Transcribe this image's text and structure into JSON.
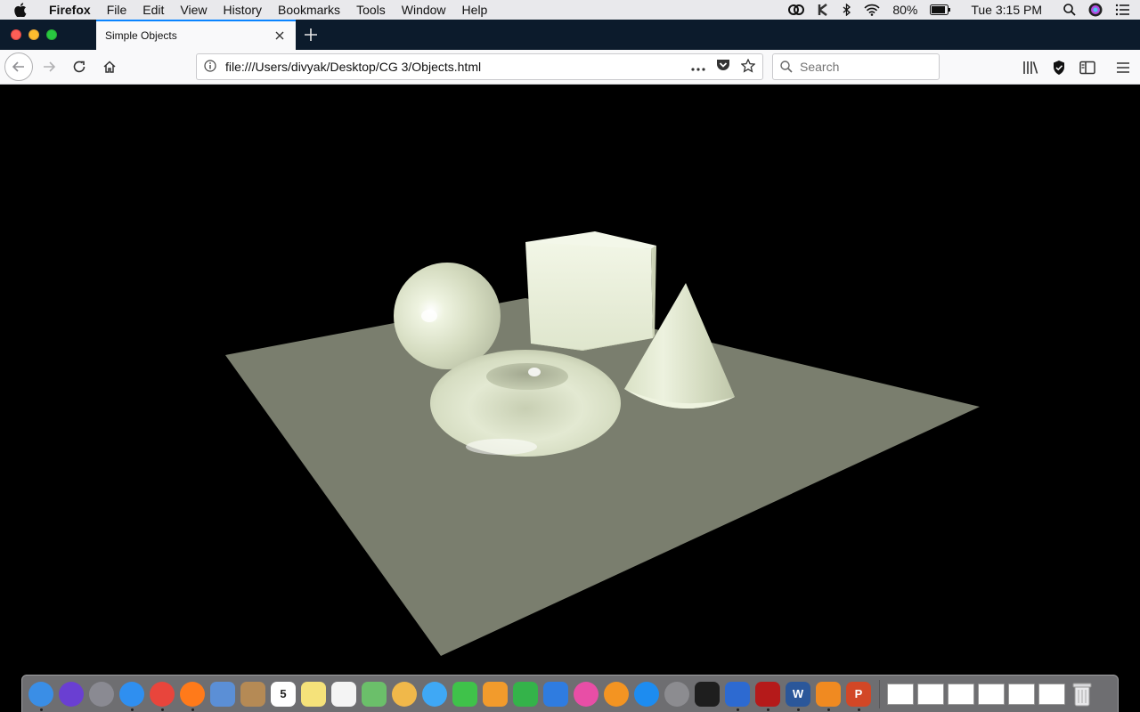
{
  "menubar": {
    "app_name": "Firefox",
    "items": [
      "File",
      "Edit",
      "View",
      "History",
      "Bookmarks",
      "Tools",
      "Window",
      "Help"
    ],
    "battery": "80%",
    "clock": "Tue 3:15 PM"
  },
  "tabs": [
    {
      "title": "Simple Objects",
      "active": true
    }
  ],
  "toolbar": {
    "url": "file:///Users/divyak/Desktop/CG 3/Objects.html",
    "search_placeholder": "Search"
  },
  "scene": {
    "background": "#000000",
    "plane_color": "#7a7e6e",
    "object_color": "#e4ebd3",
    "objects": [
      "sphere",
      "cube",
      "torus",
      "cone"
    ]
  },
  "dock": {
    "apps": [
      {
        "name": "finder",
        "color": "#3a8ee6",
        "running": true
      },
      {
        "name": "siri",
        "color": "#6a3fd2",
        "running": false
      },
      {
        "name": "launchpad",
        "color": "#8a8a92",
        "running": false
      },
      {
        "name": "safari",
        "color": "#2f8ff0",
        "running": true
      },
      {
        "name": "chrome",
        "color": "#e8453c",
        "running": true
      },
      {
        "name": "firefox",
        "color": "#ff7a1a",
        "running": true
      },
      {
        "name": "preview",
        "color": "#5b8fd6",
        "running": false
      },
      {
        "name": "contacts",
        "color": "#b58a55",
        "running": false
      },
      {
        "name": "calendar",
        "color": "#ffffff",
        "running": false,
        "label": "5"
      },
      {
        "name": "notes",
        "color": "#f5e27a",
        "running": false
      },
      {
        "name": "reminders",
        "color": "#f4f4f4",
        "running": false
      },
      {
        "name": "maps",
        "color": "#6bbf6a",
        "running": false
      },
      {
        "name": "photos",
        "color": "#f0b84a",
        "running": false
      },
      {
        "name": "messages",
        "color": "#3fa8f5",
        "running": false
      },
      {
        "name": "facetime",
        "color": "#3fc24a",
        "running": false
      },
      {
        "name": "pages",
        "color": "#f29b2c",
        "running": false
      },
      {
        "name": "numbers",
        "color": "#34b34a",
        "running": false
      },
      {
        "name": "keynote",
        "color": "#2f7ce0",
        "running": false
      },
      {
        "name": "itunes",
        "color": "#e84ea6",
        "running": false
      },
      {
        "name": "ibooks",
        "color": "#f39422",
        "running": false
      },
      {
        "name": "app-store",
        "color": "#1d8cf0",
        "running": false
      },
      {
        "name": "system-preferences",
        "color": "#8c8c90",
        "running": false
      },
      {
        "name": "terminal",
        "color": "#1e1e1e",
        "running": false
      },
      {
        "name": "wireshark",
        "color": "#2d6ad1",
        "running": true
      },
      {
        "name": "acrobat",
        "color": "#b51a1a",
        "running": true
      },
      {
        "name": "word",
        "color": "#2b579a",
        "running": true,
        "label": "W"
      },
      {
        "name": "sublime",
        "color": "#f08a21",
        "running": true
      },
      {
        "name": "powerpoint",
        "color": "#d24726",
        "running": true,
        "label": "P"
      }
    ],
    "docs": [
      "doc-1",
      "doc-2",
      "doc-3",
      "doc-4",
      "doc-5",
      "doc-6"
    ],
    "trash": "trash"
  }
}
